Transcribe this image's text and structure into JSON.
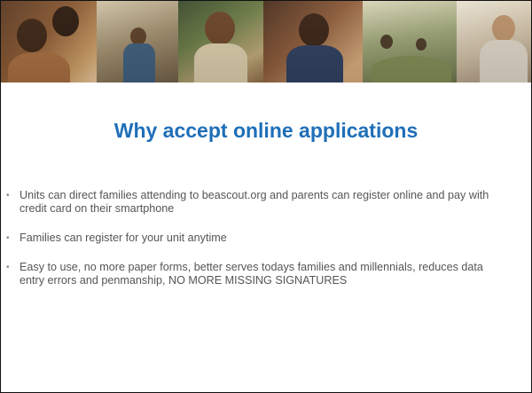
{
  "slide": {
    "title": "Why accept online applications",
    "bullet_glyph": "•",
    "bullets": [
      {
        "text": "Units can direct families attending to beascout.org and parents can register online and pay with credit card on their smartphone"
      },
      {
        "text": "Families can register for your unit anytime"
      },
      {
        "text": "Easy to use, no more paper forms, better serves todays families and millennials, reduces data entry errors and penmanship, NO MORE MISSING SIGNATURES"
      }
    ]
  },
  "colors": {
    "title": "#1f6fb8",
    "body_text": "#555555",
    "border": "#111111"
  }
}
